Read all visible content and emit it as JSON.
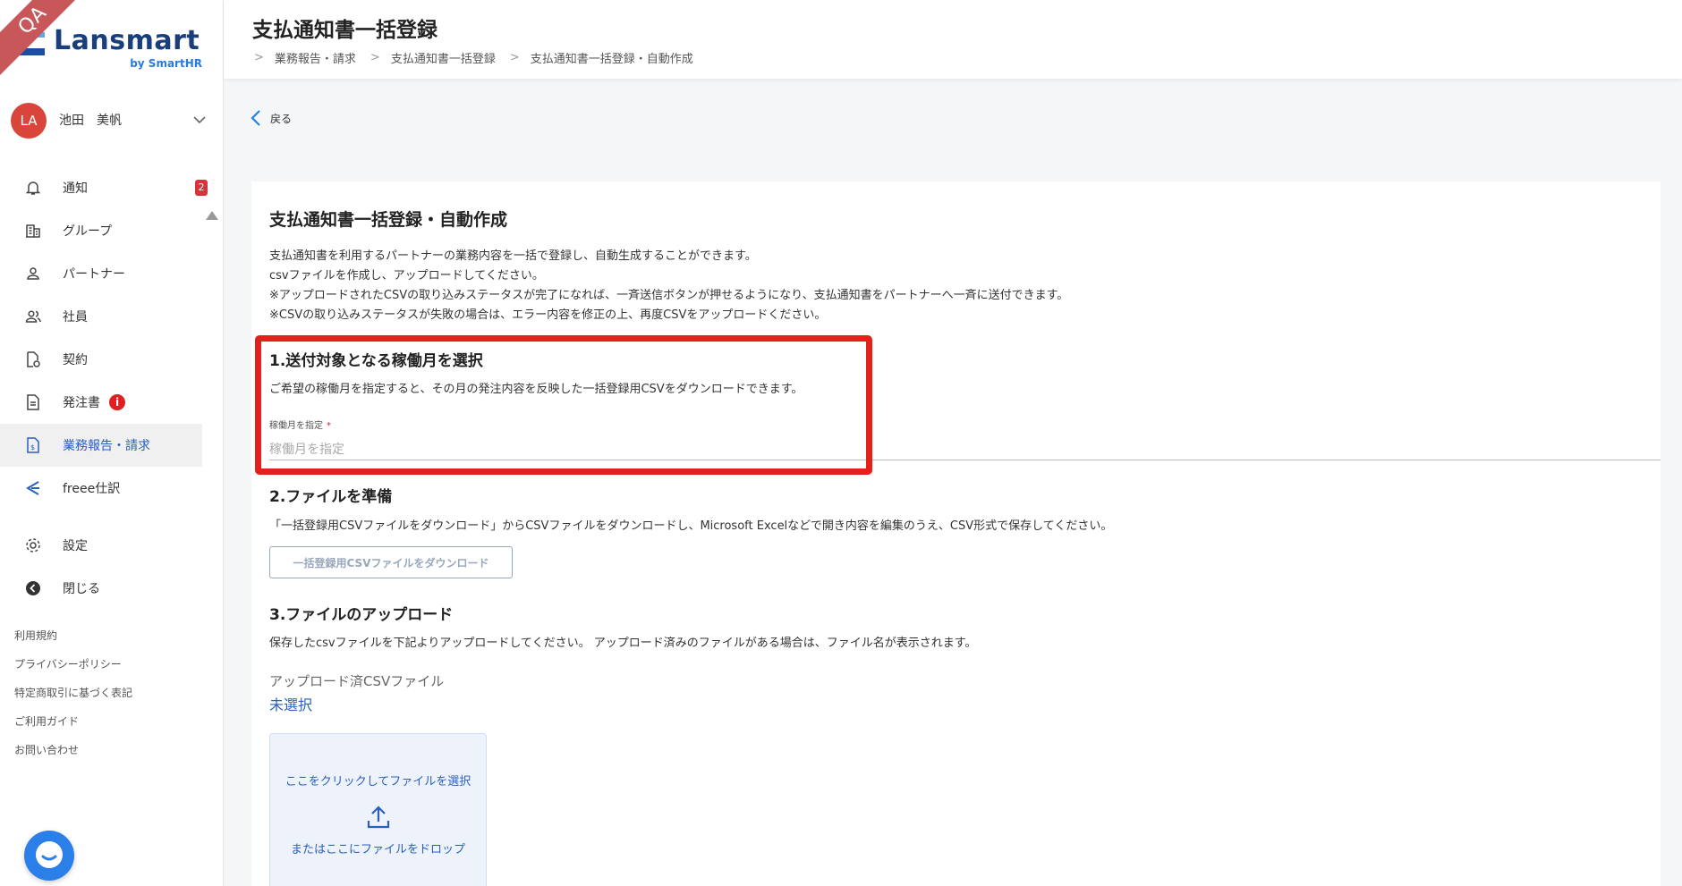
{
  "env_ribbon": "QA",
  "brand": {
    "name": "Lansmart",
    "sub": "by SmartHR"
  },
  "user": {
    "initials": "LA",
    "name": "池田　美帆"
  },
  "nav": {
    "items": [
      {
        "label": "通知",
        "badge": "2"
      },
      {
        "label": "グループ"
      },
      {
        "label": "パートナー"
      },
      {
        "label": "社員"
      },
      {
        "label": "契約"
      },
      {
        "label": "発注書",
        "info": "i"
      },
      {
        "label": "業務報告・請求",
        "active": true
      },
      {
        "label": "freee仕訳"
      },
      {
        "label": "設定"
      },
      {
        "label": "閉じる"
      }
    ]
  },
  "footer_links": [
    "利用規約",
    "プライバシーポリシー",
    "特定商取引に基づく表記",
    "ご利用ガイド",
    "お問い合わせ"
  ],
  "header": {
    "title": "支払通知書一括登録",
    "breadcrumb": [
      "業務報告・請求",
      "支払通知書一括登録",
      "支払通知書一括登録・自動作成"
    ]
  },
  "back_label": "戻る",
  "card": {
    "title": "支払通知書一括登録・自動作成",
    "description": [
      "支払通知書を利用するパートナーの業務内容を一括で登録し、自動生成することができます。",
      "csvファイルを作成し、アップロードしてください。",
      "※アップロードされたCSVの取り込みステータスが完了になれば、一斉送信ボタンが押せるようになり、支払通知書をパートナーへ一斉に送付できます。",
      "※CSVの取り込みステータスが失敗の場合は、エラー内容を修正の上、再度CSVをアップロードください。"
    ],
    "section1": {
      "title": "1.送付対象となる稼働月を選択",
      "desc": "ご希望の稼働月を指定すると、その月の発注内容を反映した一括登録用CSVをダウンロードできます。",
      "field_label": "稼働月を指定",
      "required_mark": "*",
      "placeholder": "稼働月を指定"
    },
    "section2": {
      "title": "2.ファイルを準備",
      "desc": "「一括登録用CSVファイルをダウンロード」からCSVファイルをダウンロードし、Microsoft Excelなどで開き内容を編集のうえ、CSV形式で保存してください。",
      "button": "一括登録用CSVファイルをダウンロード"
    },
    "section3": {
      "title": "3.ファイルのアップロード",
      "desc": "保存したcsvファイルを下記よりアップロードしてください。 アップロード済みのファイルがある場合は、ファイル名が表示されます。",
      "uploaded_label": "アップロード済CSVファイル",
      "uploaded_value": "未選択",
      "drop_click": "ここをクリックしてファイルを選択",
      "drop_or": "またはここにファイルをドロップ"
    }
  },
  "colors": {
    "accent": "#2a5fc0",
    "highlight": "#e4201a",
    "badge": "#d9323b"
  }
}
